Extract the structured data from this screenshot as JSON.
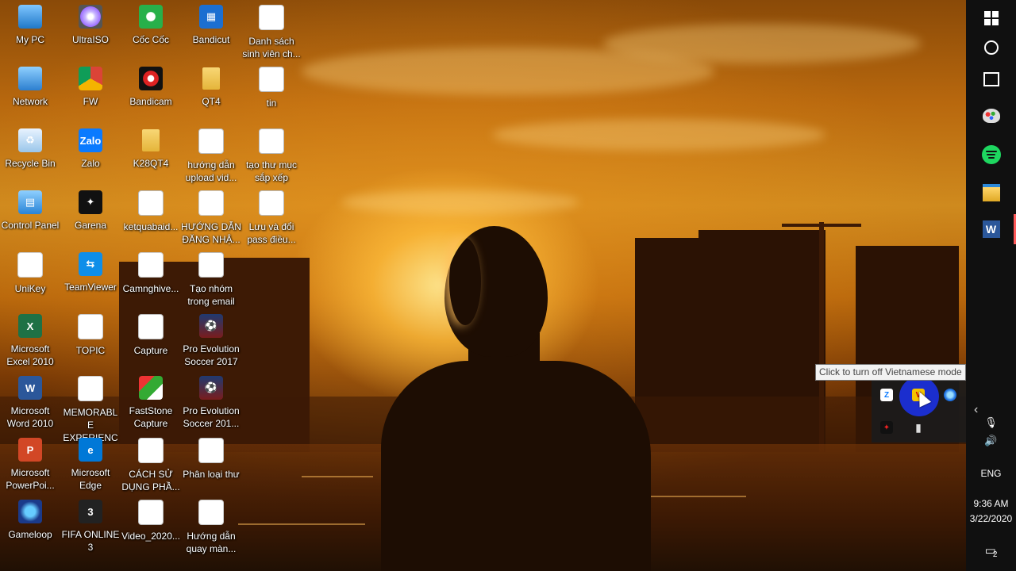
{
  "desktop": {
    "icons": [
      {
        "label": "My PC",
        "icon": "computer-icon"
      },
      {
        "label": "UltraISO",
        "icon": "disc-icon"
      },
      {
        "label": "Cốc Cốc",
        "icon": "coccoc-browser-icon"
      },
      {
        "label": "Bandicut",
        "icon": "bandicut-icon"
      },
      {
        "label": "Danh sách\nsinh viên ch...",
        "icon": "word-document-icon"
      },
      {
        "label": "Network",
        "icon": "network-icon"
      },
      {
        "label": "FW",
        "icon": "chrome-icon"
      },
      {
        "label": "Bandicam",
        "icon": "bandicam-icon"
      },
      {
        "label": "QT4",
        "icon": "folder-icon"
      },
      {
        "label": "tin",
        "icon": "image-file-icon"
      },
      {
        "label": "Recycle Bin",
        "icon": "recycle-bin-icon"
      },
      {
        "label": "Zalo",
        "icon": "zalo-icon"
      },
      {
        "label": "K28QT4",
        "icon": "folder-icon"
      },
      {
        "label": "hướng dẫn\nupload vid...",
        "icon": "video-file-icon"
      },
      {
        "label": "tạo thư mục\nsắp xếp",
        "icon": "video-file-icon"
      },
      {
        "label": "Control Panel",
        "icon": "control-panel-icon"
      },
      {
        "label": "Garena",
        "icon": "garena-icon"
      },
      {
        "label": "ketquabaid...",
        "icon": "image-file-icon"
      },
      {
        "label": "HƯỚNG DẪN\nĐĂNG NHẬ...",
        "icon": "word-document-icon"
      },
      {
        "label": "Lưu và đổi\npass điều...",
        "icon": "video-file-icon"
      },
      {
        "label": "UniKey",
        "icon": "unikey-icon"
      },
      {
        "label": "TeamViewer",
        "icon": "teamviewer-icon"
      },
      {
        "label": "Camnghive...",
        "icon": "word-document-icon"
      },
      {
        "label": "Tạo nhóm\ntrong email",
        "icon": "video-file-icon"
      },
      {
        "label": "Microsoft\nExcel 2010",
        "icon": "excel-icon"
      },
      {
        "label": "TOPIC",
        "icon": "word-document-icon"
      },
      {
        "label": "Capture",
        "icon": "image-file-icon"
      },
      {
        "label": "Pro Evolution\nSoccer 2017",
        "icon": "pes-icon"
      },
      {
        "label": "Microsoft\nWord 2010",
        "icon": "word-app-icon"
      },
      {
        "label": "MEMORABLE\nEXPERIENCE...",
        "icon": "word-document-icon"
      },
      {
        "label": "FastStone\nCapture",
        "icon": "faststone-icon"
      },
      {
        "label": "Pro Evolution\nSoccer 201...",
        "icon": "pes-icon"
      },
      {
        "label": "Microsoft\nPowerPoi...",
        "icon": "powerpoint-icon"
      },
      {
        "label": "Microsoft\nEdge",
        "icon": "edge-icon"
      },
      {
        "label": "CÁCH SỬ\nDỤNG PHẦ...",
        "icon": "word-document-icon"
      },
      {
        "label": "Phân loại thư",
        "icon": "video-file-icon"
      },
      {
        "label": "Gameloop",
        "icon": "gameloop-icon"
      },
      {
        "label": "FIFA ONLINE\n3",
        "icon": "fifa-icon"
      },
      {
        "label": "Video_2020...",
        "icon": "video-file-icon"
      },
      {
        "label": "Hướng dẫn\nquay màn...",
        "icon": "word-document-icon"
      }
    ]
  },
  "taskbar": {
    "pinned": [
      {
        "name": "windows-start-icon"
      },
      {
        "name": "cortana-icon"
      },
      {
        "name": "task-view-icon"
      },
      {
        "name": "paint-icon"
      },
      {
        "name": "spotify-icon"
      },
      {
        "name": "file-explorer-icon"
      },
      {
        "name": "word-icon",
        "letter": "W"
      }
    ],
    "language": "ENG",
    "time": "9:36 AM",
    "date": "3/22/2020",
    "notification_count": "2"
  },
  "tray_popup": {
    "tooltip": "Click to turn off Vietnamese mode",
    "icons": [
      "zalo-tray-icon",
      "unikey-tray-icon",
      "gameloop-tray-icon",
      "garena-tray-icon",
      "usb-tray-icon"
    ]
  },
  "colors": {
    "taskbar_bg": "#101010",
    "highlight": "#1b2fd8",
    "active_indicator": "#ff5a5a"
  }
}
